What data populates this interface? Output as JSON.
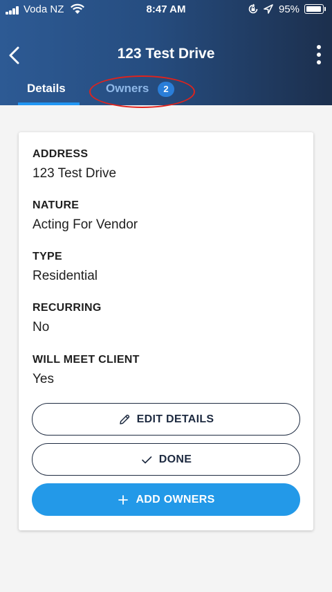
{
  "status_bar": {
    "carrier": "Voda NZ",
    "time": "8:47 AM",
    "battery_percent": "95%"
  },
  "header": {
    "title": "123 Test Drive",
    "tabs": [
      {
        "label": "Details",
        "active": true
      },
      {
        "label": "Owners",
        "badge": "2",
        "active": false
      }
    ]
  },
  "details": {
    "fields": [
      {
        "label": "ADDRESS",
        "value": "123 Test Drive"
      },
      {
        "label": "NATURE",
        "value": "Acting For Vendor"
      },
      {
        "label": "TYPE",
        "value": "Residential"
      },
      {
        "label": "RECURRING",
        "value": "No"
      },
      {
        "label": "WILL MEET CLIENT",
        "value": "Yes"
      }
    ]
  },
  "actions": {
    "edit_label": "EDIT DETAILS",
    "done_label": "DONE",
    "add_owners_label": "ADD OWNERS"
  },
  "colors": {
    "header_start": "#2d5a94",
    "header_end": "#1c2f4d",
    "primary": "#2399e8",
    "active_tab_indicator": "#2196f3",
    "annotation": "#e0231c"
  },
  "icons": [
    "signal-icon",
    "wifi-icon",
    "orientation-lock-icon",
    "location-icon",
    "battery-icon",
    "back-chevron-icon",
    "more-vertical-icon",
    "pencil-icon",
    "check-icon",
    "plus-icon"
  ]
}
